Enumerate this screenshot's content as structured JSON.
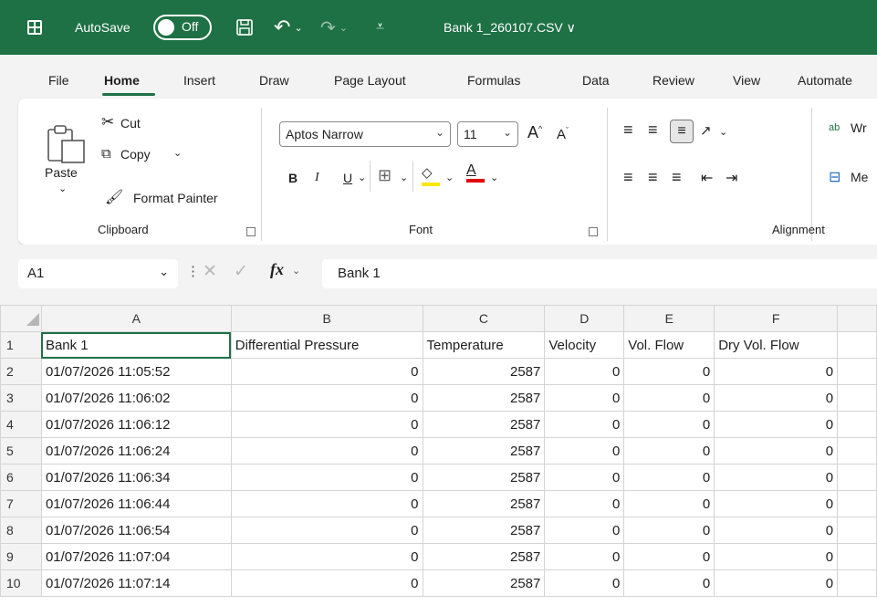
{
  "titlebar": {
    "autosave_label": "AutoSave",
    "toggle_label": "Off",
    "file_title": "Bank 1_260107.CSV ∨"
  },
  "tabs": [
    "File",
    "Home",
    "Insert",
    "Draw",
    "Page Layout",
    "Formulas",
    "Data",
    "Review",
    "View",
    "Automate"
  ],
  "ribbon": {
    "clipboard": {
      "paste": "Paste",
      "cut": "Cut",
      "copy": "Copy",
      "format_painter": "Format Painter",
      "group_label": "Clipboard"
    },
    "font": {
      "font_name": "Aptos Narrow",
      "font_size": "11",
      "bold": "B",
      "italic": "I",
      "underline": "U",
      "font_color": "A",
      "grow": "A",
      "shrink": "A",
      "group_label": "Font"
    },
    "alignment": {
      "wrap_text": "Wr",
      "merge": "Me",
      "group_label": "Alignment"
    }
  },
  "formula_bar": {
    "name_box": "A1",
    "fx": "fx",
    "value": "Bank 1"
  },
  "sheet": {
    "columns": [
      "A",
      "B",
      "C",
      "D",
      "E",
      "F"
    ],
    "rows": [
      [
        "Bank 1",
        "Differential Pressure",
        "Temperature",
        "Velocity",
        "Vol. Flow",
        "Dry Vol. Flow"
      ],
      [
        "01/07/2026 11:05:52",
        "0",
        "2587",
        "0",
        "0",
        "0"
      ],
      [
        "01/07/2026 11:06:02",
        "0",
        "2587",
        "0",
        "0",
        "0"
      ],
      [
        "01/07/2026 11:06:12",
        "0",
        "2587",
        "0",
        "0",
        "0"
      ],
      [
        "01/07/2026 11:06:24",
        "0",
        "2587",
        "0",
        "0",
        "0"
      ],
      [
        "01/07/2026 11:06:34",
        "0",
        "2587",
        "0",
        "0",
        "0"
      ],
      [
        "01/07/2026 11:06:44",
        "0",
        "2587",
        "0",
        "0",
        "0"
      ],
      [
        "01/07/2026 11:06:54",
        "0",
        "2587",
        "0",
        "0",
        "0"
      ],
      [
        "01/07/2026 11:07:04",
        "0",
        "2587",
        "0",
        "0",
        "0"
      ],
      [
        "01/07/2026 11:07:14",
        "0",
        "2587",
        "0",
        "0",
        "0"
      ]
    ],
    "active_cell": "A1"
  },
  "colors": {
    "accent": "#1e7145",
    "font_highlight": "#ffe600",
    "font_color": "#e00000"
  }
}
